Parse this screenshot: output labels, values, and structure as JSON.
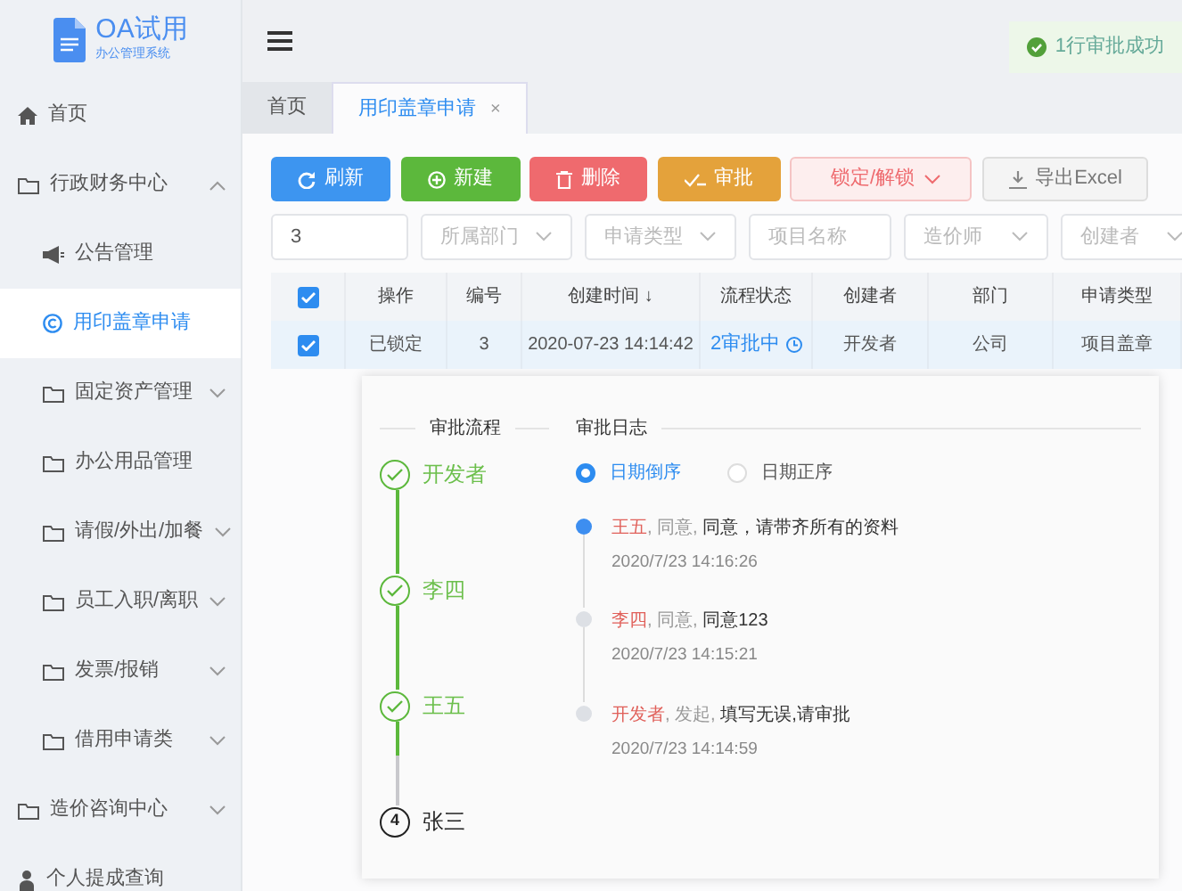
{
  "brand": {
    "title": "OA试用",
    "subtitle": "办公管理系统"
  },
  "sidebar": {
    "items": [
      {
        "label": "首页",
        "kind": "home",
        "selected": false
      },
      {
        "label": "行政财务中心",
        "kind": "folder",
        "selected": false,
        "expanded": true,
        "children": [
          {
            "label": "公告管理",
            "kind": "megaphone",
            "selected": false
          },
          {
            "label": "用印盖章申请",
            "kind": "copyright",
            "selected": true
          },
          {
            "label": "固定资产管理",
            "kind": "folder",
            "selected": false,
            "expanded": false
          },
          {
            "label": "办公用品管理",
            "kind": "folder",
            "selected": false
          },
          {
            "label": "请假/外出/加餐",
            "kind": "folder",
            "selected": false,
            "expanded": false
          },
          {
            "label": "员工入职/离职",
            "kind": "folder",
            "selected": false,
            "expanded": false
          },
          {
            "label": "发票/报销",
            "kind": "folder",
            "selected": false,
            "expanded": false
          },
          {
            "label": "借用申请类",
            "kind": "folder",
            "selected": false,
            "expanded": false
          }
        ]
      },
      {
        "label": "造价咨询中心",
        "kind": "folder",
        "selected": false,
        "expanded": false
      },
      {
        "label": "个人提成查询",
        "kind": "person",
        "selected": false
      }
    ]
  },
  "toast": {
    "text": "1行审批成功"
  },
  "tabs": [
    {
      "label": "首页",
      "selected": false,
      "closable": false
    },
    {
      "label": "用印盖章申请",
      "selected": true,
      "closable": true,
      "close": "×"
    }
  ],
  "toolbar": [
    {
      "label": "刷新",
      "kind": "refresh"
    },
    {
      "label": "新建",
      "kind": "plus"
    },
    {
      "label": "删除",
      "kind": "trash"
    },
    {
      "label": "审批",
      "kind": "check"
    },
    {
      "label": "锁定/解锁",
      "kind": "dropdown"
    },
    {
      "label": "导出Excel",
      "kind": "download"
    }
  ],
  "filters": [
    {
      "kind": "input",
      "value": "3"
    },
    {
      "kind": "select",
      "placeholder": "所属部门"
    },
    {
      "kind": "select",
      "placeholder": "申请类型"
    },
    {
      "kind": "input",
      "placeholder": "项目名称"
    },
    {
      "kind": "select",
      "placeholder": "造价师"
    },
    {
      "kind": "select",
      "placeholder": "创建者"
    }
  ],
  "table": {
    "all_checked": true,
    "columns": [
      "操作",
      "编号",
      "创建时间 ↓",
      "流程状态",
      "创建者",
      "部门",
      "申请类型"
    ],
    "rows": [
      {
        "checked": true,
        "cells": [
          "已锁定",
          "3",
          "2020-07-23 14:14:42",
          "2审批中",
          "开发者",
          "公司",
          "项目盖章"
        ]
      }
    ]
  },
  "detail": {
    "flow_title": "审批流程",
    "steps": [
      {
        "name": "开发者",
        "done": true
      },
      {
        "name": "李四",
        "done": true
      },
      {
        "name": "王五",
        "done": true
      },
      {
        "name": "张三",
        "done": false,
        "number": "4"
      }
    ],
    "log_title": "审批日志",
    "sort_options": [
      {
        "label": "日期倒序",
        "selected": true
      },
      {
        "label": "日期正序",
        "selected": false
      }
    ],
    "log": [
      {
        "name": "王五",
        "action": ", 同意, ",
        "comment": "同意，请带齐所有的资料",
        "time": "2020/7/23 14:16:26",
        "latest": true
      },
      {
        "name": "李四",
        "action": ", 同意, ",
        "comment": "同意123",
        "time": "2020/7/23 14:15:21",
        "latest": false
      },
      {
        "name": "开发者",
        "action": ", 发起, ",
        "comment": "填写无误,请审批",
        "time": "2020/7/23 14:14:59",
        "latest": false
      }
    ]
  }
}
